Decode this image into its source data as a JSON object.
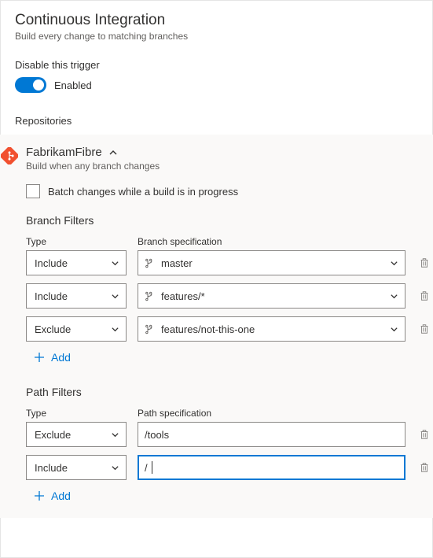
{
  "header": {
    "title": "Continuous Integration",
    "subtitle": "Build every change to matching branches"
  },
  "trigger": {
    "label": "Disable this trigger",
    "state_text": "Enabled"
  },
  "repositories_label": "Repositories",
  "repo": {
    "name": "FabrikamFibre",
    "description": "Build when any branch changes",
    "batch_label": "Batch changes while a build is in progress"
  },
  "branch_filters": {
    "title": "Branch Filters",
    "type_header": "Type",
    "spec_header": "Branch specification",
    "rows": [
      {
        "type": "Include",
        "spec": "master"
      },
      {
        "type": "Include",
        "spec": "features/*"
      },
      {
        "type": "Exclude",
        "spec": "features/not-this-one"
      }
    ],
    "add_label": "Add"
  },
  "path_filters": {
    "title": "Path Filters",
    "type_header": "Type",
    "spec_header": "Path specification",
    "rows": [
      {
        "type": "Exclude",
        "spec": "/tools"
      },
      {
        "type": "Include",
        "spec": "/"
      }
    ],
    "add_label": "Add"
  }
}
